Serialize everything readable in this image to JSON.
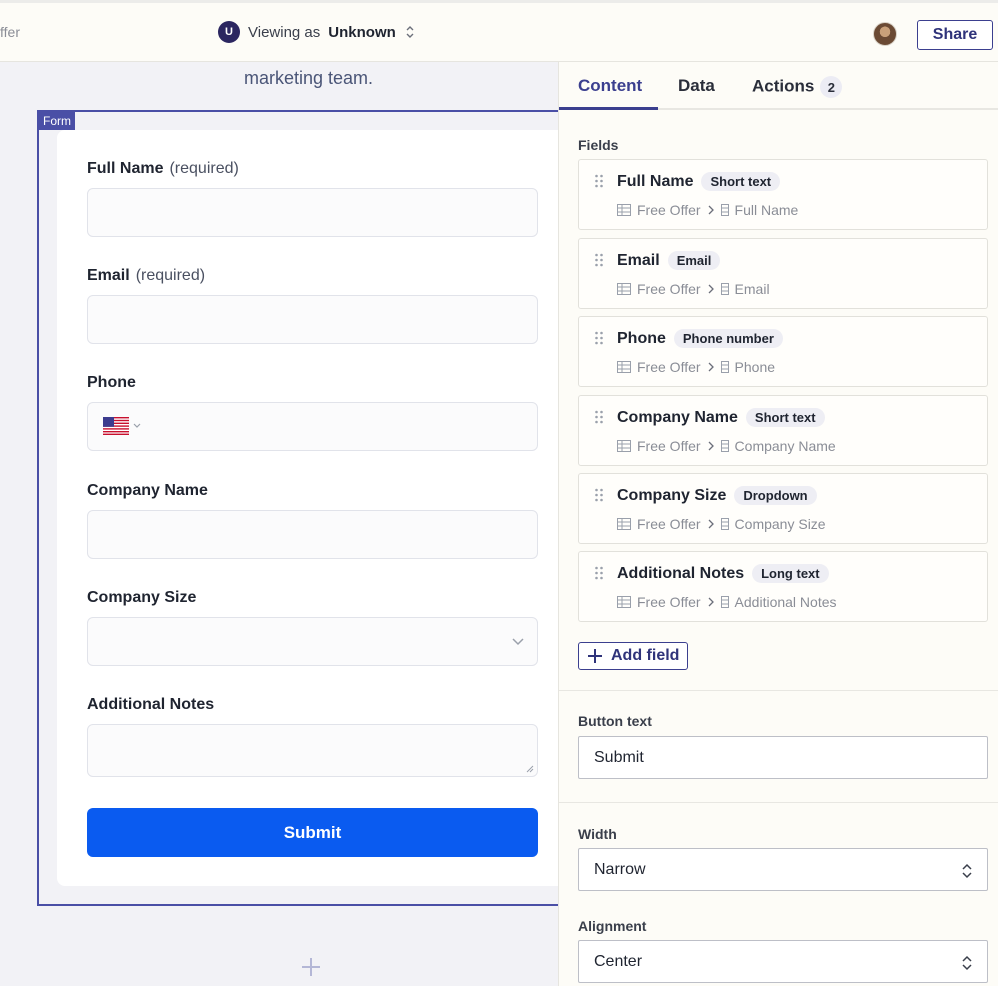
{
  "topbar": {
    "crumb": "ffer",
    "viewing_badge": "U",
    "viewing_prefix": "Viewing as",
    "viewing_user": "Unknown",
    "share_label": "Share"
  },
  "canvas": {
    "intro_text": "marketing team.",
    "form_tag": "Form",
    "required_text": "(required)",
    "fields": [
      {
        "label": "Full Name",
        "required": true
      },
      {
        "label": "Email",
        "required": true
      },
      {
        "label": "Phone",
        "required": false
      },
      {
        "label": "Company Name",
        "required": false
      },
      {
        "label": "Company Size",
        "required": false
      },
      {
        "label": "Additional Notes",
        "required": false
      }
    ],
    "submit_label": "Submit"
  },
  "panel": {
    "tabs": [
      {
        "label": "Content",
        "active": true
      },
      {
        "label": "Data",
        "active": false
      },
      {
        "label": "Actions",
        "count": "2",
        "active": false
      }
    ],
    "fields_label": "Fields",
    "field_cards": [
      {
        "name": "Full Name",
        "type": "Short text",
        "table": "Free Offer",
        "column": "Full Name"
      },
      {
        "name": "Email",
        "type": "Email",
        "table": "Free Offer",
        "column": "Email"
      },
      {
        "name": "Phone",
        "type": "Phone number",
        "table": "Free Offer",
        "column": "Phone"
      },
      {
        "name": "Company Name",
        "type": "Short text",
        "table": "Free Offer",
        "column": "Company Name"
      },
      {
        "name": "Company Size",
        "type": "Dropdown",
        "table": "Free Offer",
        "column": "Company Size"
      },
      {
        "name": "Additional Notes",
        "type": "Long text",
        "table": "Free Offer",
        "column": "Additional Notes"
      }
    ],
    "add_field_label": "Add field",
    "button_text_label": "Button text",
    "button_text_value": "Submit",
    "width_label": "Width",
    "width_value": "Narrow",
    "alignment_label": "Alignment",
    "alignment_value": "Center"
  },
  "colors": {
    "accent": "#3b3f8f",
    "submit": "#0a5bf0",
    "panel_bg": "#fdfcf7",
    "canvas_bg": "#f2f2f6"
  }
}
